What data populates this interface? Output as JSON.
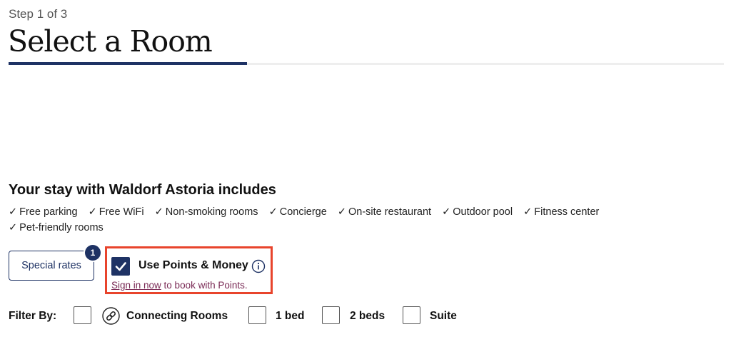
{
  "header": {
    "step": "Step 1 of 3",
    "title": "Select a Room",
    "progress_fraction": 0.333
  },
  "stay": {
    "heading": "Your stay with Waldorf Astoria includes",
    "check_glyph": "✓",
    "amenities": [
      "Free parking",
      "Free WiFi",
      "Non-smoking rooms",
      "Concierge",
      "On-site restaurant",
      "Outdoor pool",
      "Fitness center",
      "Pet-friendly rooms"
    ]
  },
  "rates": {
    "special_rates_label": "Special rates",
    "special_rates_badge": "1"
  },
  "points": {
    "checked": true,
    "label": "Use Points & Money",
    "info_icon": "info-icon",
    "sign_in_link": "Sign in now",
    "sign_in_suffix": " to book with Points."
  },
  "filters": {
    "label": "Filter By:",
    "items": [
      {
        "label": "",
        "icon": "link-icon",
        "checked": false
      },
      {
        "label": "Connecting Rooms",
        "checked": false
      },
      {
        "label": "1 bed",
        "checked": false
      },
      {
        "label": "2 beds",
        "checked": false
      },
      {
        "label": "Suite",
        "checked": false
      }
    ]
  },
  "colors": {
    "navy": "#1e3264",
    "highlight": "#e8442c",
    "link": "#7a2a55"
  }
}
